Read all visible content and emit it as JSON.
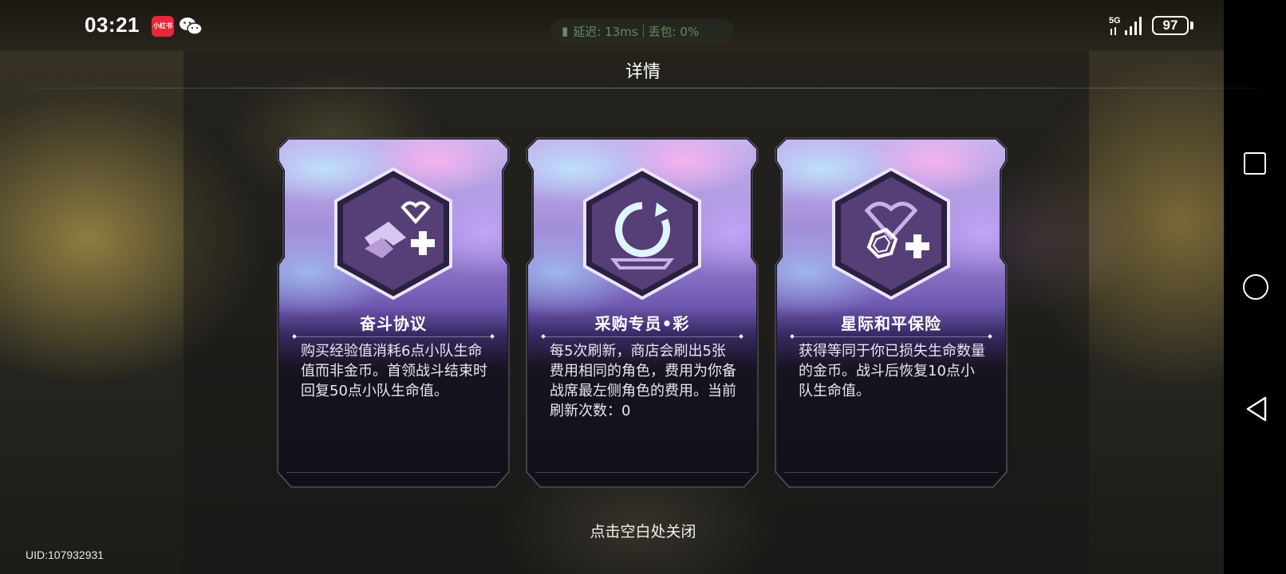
{
  "status_bar": {
    "time": "03:21",
    "app_icon_label": "小红书",
    "network": {
      "latency": "延迟: 13ms",
      "packet_loss": "丢包: 0%"
    },
    "signal": "5G",
    "battery": "97"
  },
  "dialog": {
    "title": "详情",
    "close_hint": "点击空白处关闭"
  },
  "cards": [
    {
      "name": "奋斗协议",
      "icon": "heart-arrow-plus-icon",
      "description": "购买经验值消耗6点小队生命值而非金币。首领战斗结束时回复50点小队生命值。"
    },
    {
      "name": "采购专员•彩",
      "icon": "refresh-icon",
      "description": "每5次刷新，商店会刷出5张费用相同的角色，费用为你备战席最左侧角色的费用。当前刷新次数：0"
    },
    {
      "name": "星际和平保险",
      "icon": "heart-coin-plus-icon",
      "description": "获得等同于你已损失生命数量的金币。战斗后恢复10点小队生命值。"
    }
  ],
  "footer": {
    "uid": "UID:107932931"
  },
  "colors": {
    "card_top": "#c7b5ee",
    "card_bottom": "#111018",
    "accent_purple": "#9f88d6"
  }
}
